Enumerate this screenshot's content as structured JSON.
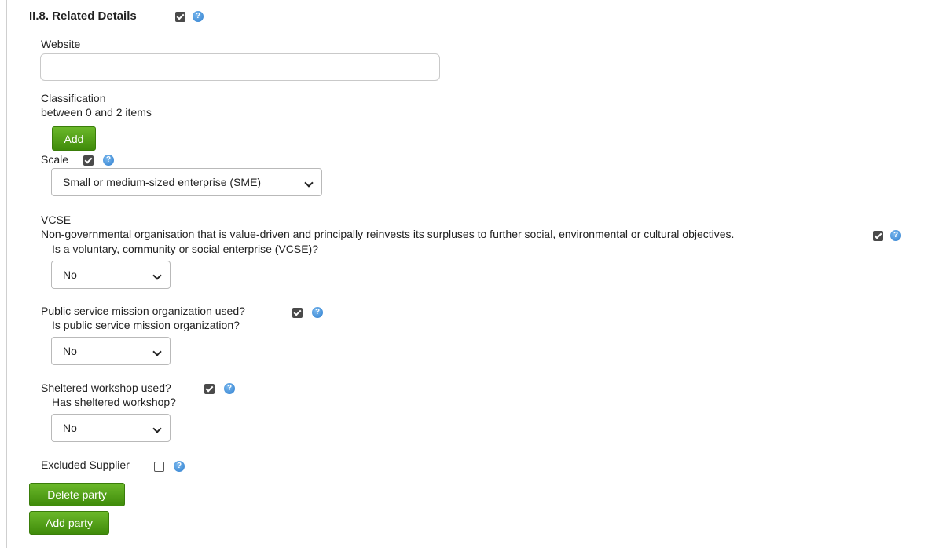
{
  "section": {
    "title": "II.8. Related Details"
  },
  "website": {
    "label": "Website",
    "value": ""
  },
  "classification": {
    "label": "Classification",
    "hint": "between 0 and 2 items",
    "add_label": "Add"
  },
  "scale": {
    "label": "Scale",
    "selected": "Small or medium-sized enterprise (SME)"
  },
  "vcse": {
    "heading": "VCSE",
    "description": "Non-governmental organisation that is value-driven and principally reinvests its surpluses to further social, environmental or cultural objectives.",
    "question": "Is a voluntary, community or social enterprise (VCSE)?",
    "selected": "No"
  },
  "public_service": {
    "label": "Public service mission organization used?",
    "question": "Is public service mission organization?",
    "selected": "No"
  },
  "sheltered": {
    "label": "Sheltered workshop used?",
    "question": "Has sheltered workshop?",
    "selected": "No"
  },
  "excluded": {
    "label": "Excluded Supplier"
  },
  "actions": {
    "delete_label": "Delete party",
    "add_label": "Add party"
  },
  "icons": {
    "help": "help-icon",
    "checkbox": "checkbox"
  },
  "colors": {
    "button_green": "#4f9e14",
    "help_blue": "#2f7fcf"
  }
}
